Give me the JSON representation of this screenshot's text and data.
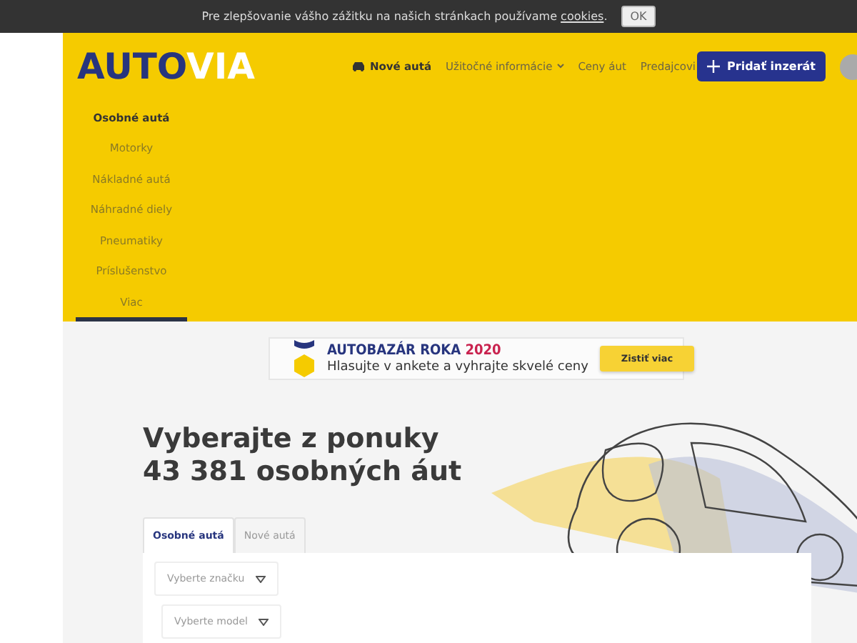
{
  "cookie_bar": {
    "text": "Pre zlepšovanie vášho zážitku na našich stránkach používame ",
    "link": "cookies",
    "after": ".",
    "button": "OK"
  },
  "header": {
    "logo": {
      "part1": "AUTO",
      "part2": "VIA"
    },
    "nav": [
      {
        "label": "Nové autá",
        "kind": "car"
      },
      {
        "label": "Užitočné informácie",
        "kind": "dropdown"
      },
      {
        "label": "Ceny áut",
        "kind": "plain"
      },
      {
        "label": "Predajcovi",
        "kind": "plain"
      }
    ],
    "add_button": "Pridať inzerát",
    "categories": [
      {
        "label": "Osobné autá",
        "selected": true
      },
      {
        "label": "Motorky",
        "selected": false
      },
      {
        "label": "Nákladné autá",
        "selected": false
      },
      {
        "label": "Náhradné diely",
        "selected": false
      },
      {
        "label": "Pneumatiky",
        "selected": false
      },
      {
        "label": "Príslušenstvo",
        "selected": false
      },
      {
        "label": "Viac",
        "selected": false
      }
    ]
  },
  "banner": {
    "title": "AUTOBAZÁR ROKA",
    "year": "2020",
    "text": "Hlasujte v ankete a vyhrajte skvelé ceny",
    "button": "Zistiť viac"
  },
  "search": {
    "heading_line1": "Vyberajte z ponuky",
    "heading_line2": "43 381 osobných áut",
    "tabs": [
      {
        "label": "Osobné autá",
        "selected": true
      },
      {
        "label": "Nové autá",
        "selected": false
      }
    ],
    "selects": [
      {
        "placeholder": "Vyberte značku"
      },
      {
        "placeholder": "Vyberte model"
      }
    ]
  }
}
